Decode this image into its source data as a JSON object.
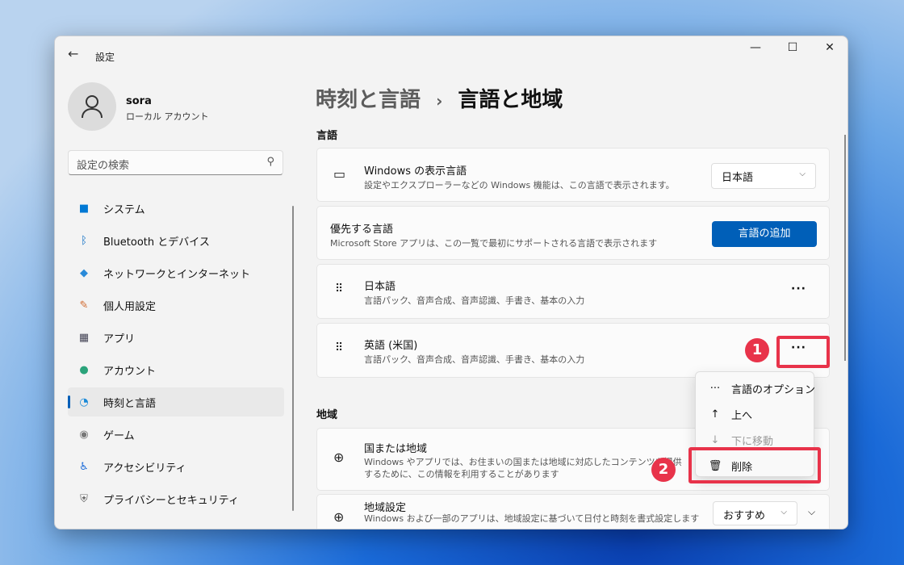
{
  "window": {
    "title": "設定",
    "back_icon": "arrow-left-icon",
    "minimize": "—",
    "maximize": "☐",
    "close": "✕"
  },
  "user": {
    "name": "sora",
    "account": "ローカル アカウント"
  },
  "search": {
    "placeholder": "設定の検索"
  },
  "sidebar": {
    "items": [
      {
        "label": "システム",
        "icon": "■",
        "color": "#0078d4"
      },
      {
        "label": "Bluetooth とデバイス",
        "icon": "ᛒ",
        "color": "#0067c0"
      },
      {
        "label": "ネットワークとインターネット",
        "icon": "◆",
        "color": "#2a8ad8"
      },
      {
        "label": "個人用設定",
        "icon": "✎",
        "color": "#d06a30"
      },
      {
        "label": "アプリ",
        "icon": "▦",
        "color": "#445"
      },
      {
        "label": "アカウント",
        "icon": "●",
        "color": "#2aa37a"
      },
      {
        "label": "時刻と言語",
        "icon": "◔",
        "color": "#1a8ad8"
      },
      {
        "label": "ゲーム",
        "icon": "◉",
        "color": "#777"
      },
      {
        "label": "アクセシビリティ",
        "icon": "♿",
        "color": "#1a6ad8"
      },
      {
        "label": "プライバシーとセキュリティ",
        "icon": "⛨",
        "color": "#666"
      }
    ],
    "selected": 6
  },
  "breadcrumb": {
    "parent": "時刻と言語",
    "sep": "›",
    "current": "言語と地域"
  },
  "language_section": {
    "heading": "言語",
    "display": {
      "title": "Windows の表示言語",
      "subtitle": "設定やエクスプローラーなどの Windows 機能は、この言語で表示されます。",
      "value": "日本語"
    },
    "preferred": {
      "title": "優先する言語",
      "subtitle": "Microsoft Store アプリは、この一覧で最初にサポートされる言語で表示されます",
      "button": "言語の追加"
    },
    "languages": [
      {
        "name": "日本語",
        "features": "言語パック、音声合成、音声認識、手書き、基本の入力"
      },
      {
        "name": "英語 (米国)",
        "features": "言語パック、音声合成、音声認識、手書き、基本の入力"
      }
    ]
  },
  "context_menu": {
    "items": [
      {
        "label": "言語のオプション",
        "icon": "···",
        "disabled": false
      },
      {
        "label": "上へ",
        "icon": "↑",
        "disabled": false
      },
      {
        "label": "下に移動",
        "icon": "↓",
        "disabled": true
      },
      {
        "label": "削除",
        "icon": "🗑",
        "disabled": false
      }
    ]
  },
  "region_section": {
    "heading": "地域",
    "country": {
      "title": "国または地域",
      "subtitle": "Windows やアプリでは、お住まいの国または地域に対応したコンテンツを提供するために、この情報を利用することがあります"
    },
    "format": {
      "title": "地域設定",
      "subtitle": "Windows および一部のアプリは、地域設定に基づいて日付と時刻を書式設定します",
      "value": "おすすめ"
    }
  },
  "annotations": {
    "step1": "1",
    "step2": "2",
    "accent": "#e8334a"
  }
}
